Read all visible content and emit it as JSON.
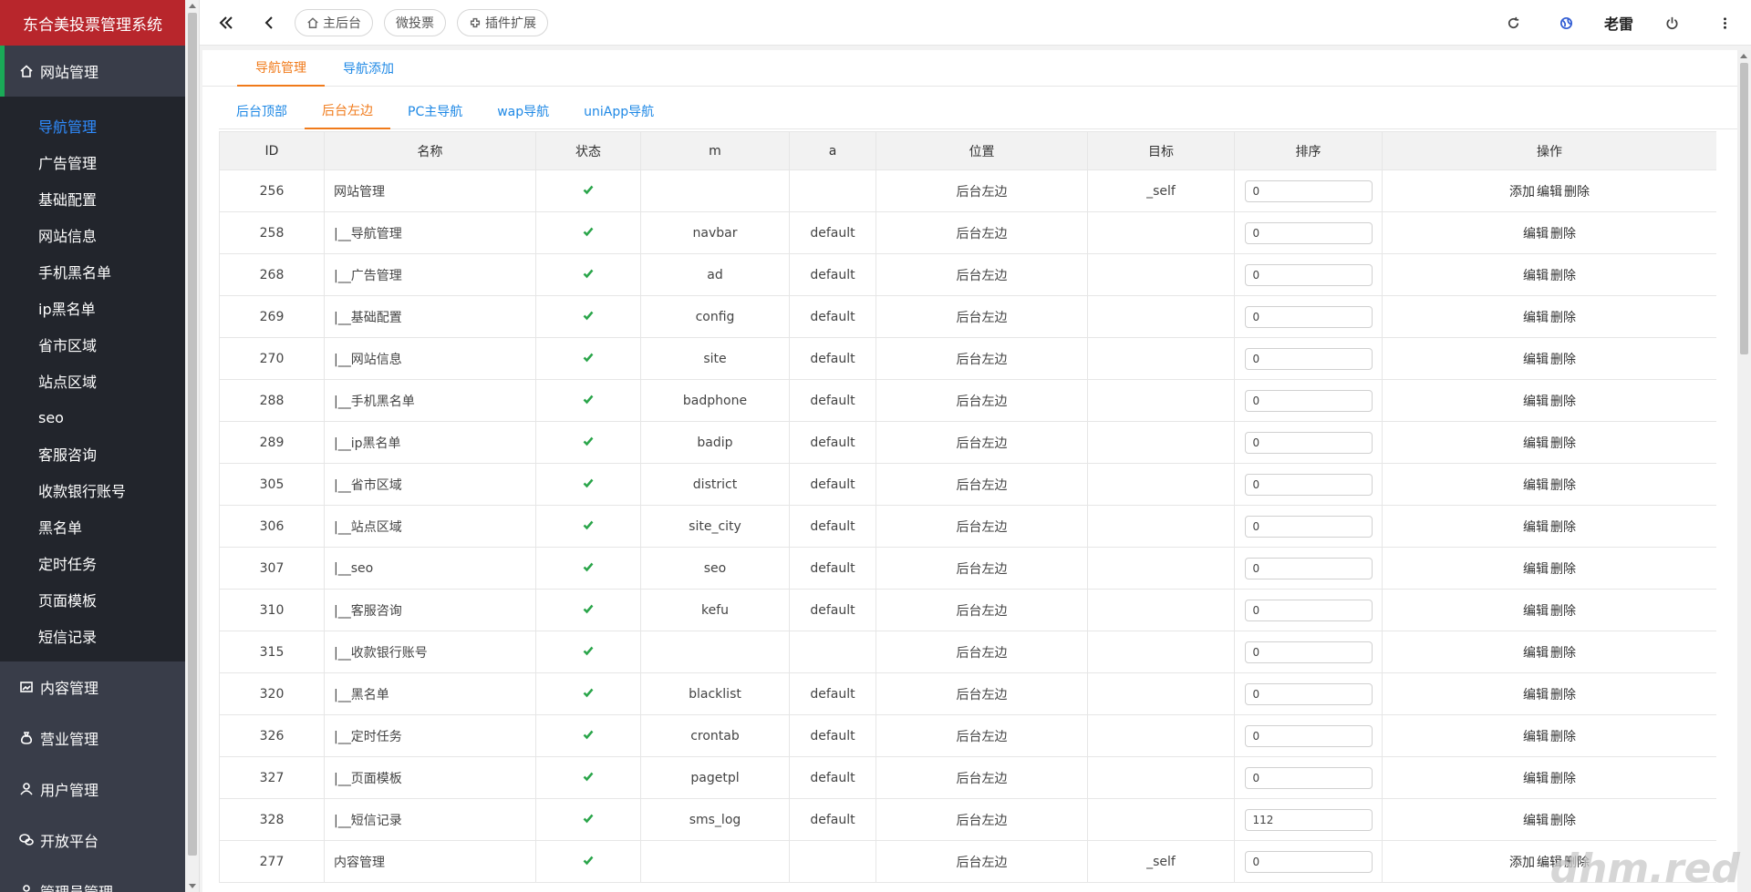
{
  "app": {
    "title": "东合美投票管理系统"
  },
  "sidebar": {
    "groups": [
      {
        "label": "网站管理",
        "icon": "home-icon"
      },
      {
        "label": "内容管理",
        "icon": "image-icon"
      },
      {
        "label": "营业管理",
        "icon": "money-bag-icon"
      },
      {
        "label": "用户管理",
        "icon": "user-icon"
      },
      {
        "label": "开放平台",
        "icon": "chat-icon"
      },
      {
        "label": "管理员管理",
        "icon": "admin-icon"
      }
    ],
    "sub_items": [
      "导航管理",
      "广告管理",
      "基础配置",
      "网站信息",
      "手机黑名单",
      "ip黑名单",
      "省市区域",
      "站点区域",
      "seo",
      "客服咨询",
      "收款银行账号",
      "黑名单",
      "定时任务",
      "页面模板",
      "短信记录"
    ]
  },
  "topbar": {
    "buttons": [
      "主后台",
      "微投票",
      "插件扩展"
    ],
    "user": "老雷"
  },
  "tabs_primary": [
    "导航管理",
    "导航添加"
  ],
  "tabs_secondary": [
    "后台顶部",
    "后台左边",
    "PC主导航",
    "wap导航",
    "uniApp导航"
  ],
  "table": {
    "headers": [
      "ID",
      "名称",
      "状态",
      "m",
      "a",
      "位置",
      "目标",
      "排序",
      "操作"
    ],
    "rows": [
      {
        "id": "256",
        "name": "网站管理",
        "m": "",
        "a": "",
        "pos": "后台左边",
        "target": "_self",
        "sort": "0",
        "ops": [
          "添加",
          "编辑",
          "删除"
        ]
      },
      {
        "id": "258",
        "name": "|__导航管理",
        "m": "navbar",
        "a": "default",
        "pos": "后台左边",
        "target": "",
        "sort": "0",
        "ops": [
          "编辑",
          "删除"
        ]
      },
      {
        "id": "268",
        "name": "|__广告管理",
        "m": "ad",
        "a": "default",
        "pos": "后台左边",
        "target": "",
        "sort": "0",
        "ops": [
          "编辑",
          "删除"
        ]
      },
      {
        "id": "269",
        "name": "|__基础配置",
        "m": "config",
        "a": "default",
        "pos": "后台左边",
        "target": "",
        "sort": "0",
        "ops": [
          "编辑",
          "删除"
        ]
      },
      {
        "id": "270",
        "name": "|__网站信息",
        "m": "site",
        "a": "default",
        "pos": "后台左边",
        "target": "",
        "sort": "0",
        "ops": [
          "编辑",
          "删除"
        ]
      },
      {
        "id": "288",
        "name": "|__手机黑名单",
        "m": "badphone",
        "a": "default",
        "pos": "后台左边",
        "target": "",
        "sort": "0",
        "ops": [
          "编辑",
          "删除"
        ]
      },
      {
        "id": "289",
        "name": "|__ip黑名单",
        "m": "badip",
        "a": "default",
        "pos": "后台左边",
        "target": "",
        "sort": "0",
        "ops": [
          "编辑",
          "删除"
        ]
      },
      {
        "id": "305",
        "name": "|__省市区域",
        "m": "district",
        "a": "default",
        "pos": "后台左边",
        "target": "",
        "sort": "0",
        "ops": [
          "编辑",
          "删除"
        ]
      },
      {
        "id": "306",
        "name": "|__站点区域",
        "m": "site_city",
        "a": "default",
        "pos": "后台左边",
        "target": "",
        "sort": "0",
        "ops": [
          "编辑",
          "删除"
        ]
      },
      {
        "id": "307",
        "name": "|__seo",
        "m": "seo",
        "a": "default",
        "pos": "后台左边",
        "target": "",
        "sort": "0",
        "ops": [
          "编辑",
          "删除"
        ]
      },
      {
        "id": "310",
        "name": "|__客服咨询",
        "m": "kefu",
        "a": "default",
        "pos": "后台左边",
        "target": "",
        "sort": "0",
        "ops": [
          "编辑",
          "删除"
        ]
      },
      {
        "id": "315",
        "name": "|__收款银行账号",
        "m": "",
        "a": "",
        "pos": "后台左边",
        "target": "",
        "sort": "0",
        "ops": [
          "编辑",
          "删除"
        ]
      },
      {
        "id": "320",
        "name": "|__黑名单",
        "m": "blacklist",
        "a": "default",
        "pos": "后台左边",
        "target": "",
        "sort": "0",
        "ops": [
          "编辑",
          "删除"
        ]
      },
      {
        "id": "326",
        "name": "|__定时任务",
        "m": "crontab",
        "a": "default",
        "pos": "后台左边",
        "target": "",
        "sort": "0",
        "ops": [
          "编辑",
          "删除"
        ]
      },
      {
        "id": "327",
        "name": "|__页面模板",
        "m": "pagetpl",
        "a": "default",
        "pos": "后台左边",
        "target": "",
        "sort": "0",
        "ops": [
          "编辑",
          "删除"
        ]
      },
      {
        "id": "328",
        "name": "|__短信记录",
        "m": "sms_log",
        "a": "default",
        "pos": "后台左边",
        "target": "",
        "sort": "112",
        "ops": [
          "编辑",
          "删除"
        ]
      },
      {
        "id": "277",
        "name": "内容管理",
        "m": "",
        "a": "",
        "pos": "后台左边",
        "target": "_self",
        "sort": "0",
        "ops": [
          "添加",
          "编辑",
          "删除"
        ]
      }
    ]
  },
  "watermark": "dhm.red",
  "colors": {
    "brand": "#b8262c",
    "sidebar": "#393d49",
    "submenu": "#22252c",
    "accent": "#f07a1a",
    "link": "#1e88e5",
    "check": "#2aa54a"
  }
}
